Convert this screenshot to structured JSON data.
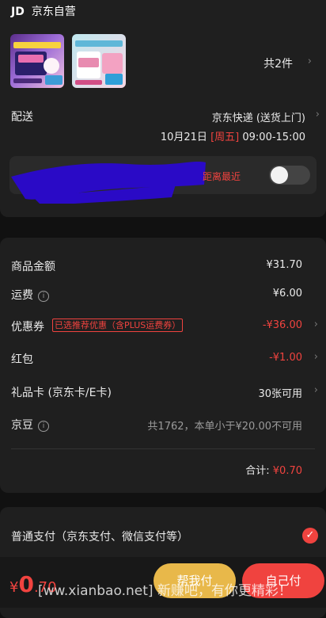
{
  "store": {
    "logo": "JD",
    "name": "京东自营"
  },
  "items": {
    "count_text": "共2件",
    "chevron": "›"
  },
  "delivery": {
    "label": "配送",
    "method": "京东快递 (送货上门)",
    "date": "10月21日",
    "weekday": "[周五]",
    "time": "09:00-15:00",
    "nearest_tag": "距离最近"
  },
  "summary": {
    "goods_label": "商品金额",
    "goods_value": "¥31.70",
    "freight_label": "运费",
    "freight_value": "¥6.00",
    "coupon_label": "优惠券",
    "coupon_tag": "已选推荐优惠（含PLUS运费券）",
    "coupon_value": "-¥36.00",
    "redpacket_label": "红包",
    "redpacket_value": "-¥1.00",
    "giftcard_label": "礼品卡 (京东卡/E卡)",
    "giftcard_value": "30张可用",
    "jingdou_label": "京豆",
    "jingdou_value": "共1762，本单小于¥20.00不可用",
    "total_label": "合计:",
    "total_value": "¥0.70"
  },
  "payment": {
    "label": "普通支付（京东支付、微信支付等）"
  },
  "footer": {
    "price_symbol": "¥",
    "price_int": "0",
    "price_dec": ".70",
    "help_pay": "帮我付",
    "self_pay": "自己付",
    "watermark": "[ww.xianbao.net] 新赚吧，有你更精彩！"
  },
  "colors": {
    "accent": "#f0433f",
    "gold": "#e8b84a",
    "card": "#1f1f1f",
    "bg": "#111111"
  }
}
